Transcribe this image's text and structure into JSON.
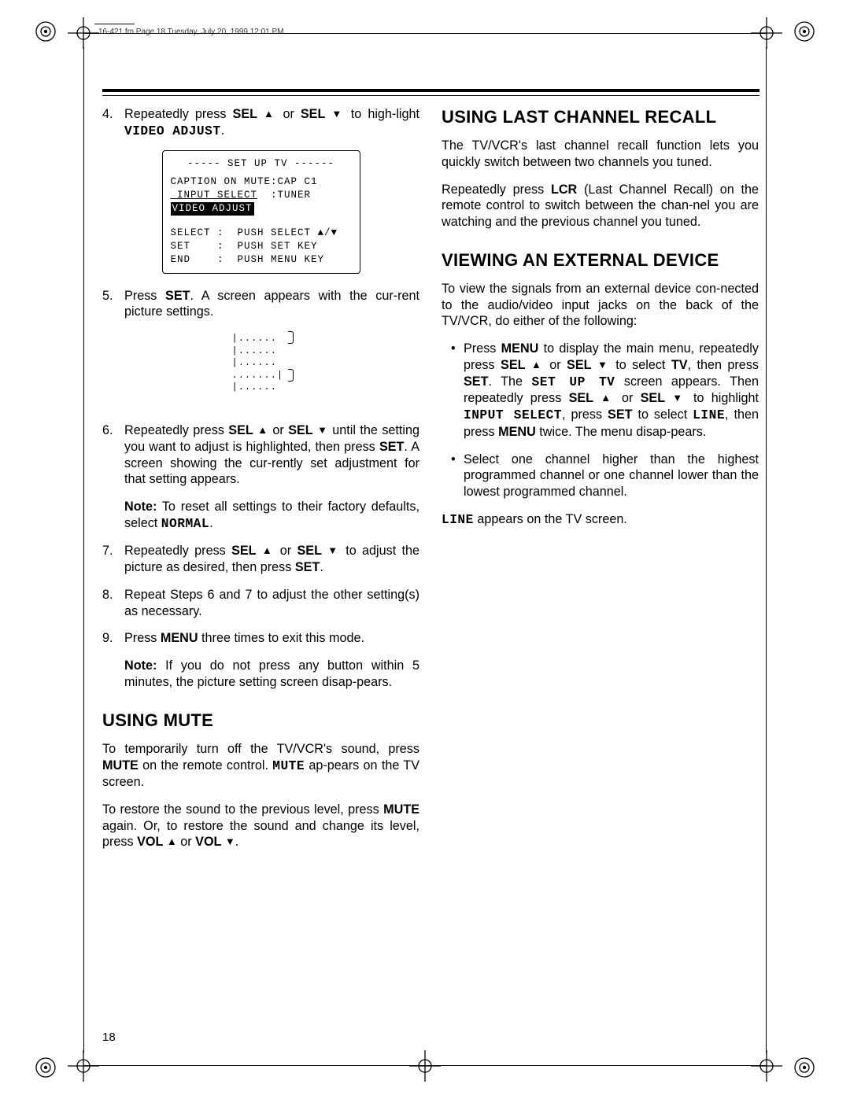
{
  "header": {
    "running": "16-421.fm  Page 18  Tuesday, July 20, 1999  12:01 PM"
  },
  "page_number": "18",
  "left": {
    "step4": {
      "num": "4.",
      "text_a": "Repeatedly press ",
      "sel": "SEL",
      "or": " or ",
      "text_b": " to high-light ",
      "video_adjust": "VIDEO ADJUST",
      "period": "."
    },
    "osd": {
      "title": "----- SET UP TV ------",
      "row1_label": "CAPTION ON MUTE",
      "row1_val": ":CAP C1",
      "row2_label": " INPUT SELECT",
      "row2_val": "  :TUNER",
      "row3_hl": "VIDEO ADJUST",
      "help1": "SELECT :  PUSH SELECT ▲/▼",
      "help2": "SET    :  PUSH SET KEY",
      "help3": "END    :  PUSH MENU KEY"
    },
    "step5": {
      "num": "5.",
      "a": "Press ",
      "set": "SET",
      "b": ". A screen appears with the cur-rent picture settings."
    },
    "step6": {
      "num": "6.",
      "a": "Repeatedly press ",
      "sel": "SEL",
      "or": " or ",
      "b": " until the setting you want to adjust is highlighted, then press ",
      "set": "SET",
      "c": ". A screen showing the cur-rently set adjustment for that setting appears."
    },
    "note6": {
      "lead": "Note:",
      "a": " To reset all settings to their factory defaults, select ",
      "normal": "NORMAL",
      "b": "."
    },
    "step7": {
      "num": "7.",
      "a": "Repeatedly press ",
      "sel": "SEL",
      "or": " or ",
      "b": " to adjust the picture as desired, then press ",
      "set": "SET",
      "c": "."
    },
    "step8": {
      "num": "8.",
      "text": "Repeat Steps 6 and 7 to adjust the other setting(s) as necessary."
    },
    "step9": {
      "num": "9.",
      "a": "Press ",
      "menu": "MENU",
      "b": " three times to exit this mode."
    },
    "note9": {
      "lead": "Note:",
      "text": " If you do not press any button within 5 minutes, the picture setting screen disap-pears."
    },
    "mute": {
      "heading": "USING MUTE",
      "p1_a": "To temporarily turn off the TV/VCR's sound, press ",
      "p1_mute": "MUTE",
      "p1_b": " on the remote control. ",
      "p1_mute2": "MUTE",
      "p1_c": " ap-pears on the TV screen.",
      "p2_a": "To restore the sound to the previous level, press ",
      "p2_mute": "MUTE",
      "p2_b": " again. Or, to restore the sound and change its level, press ",
      "p2_vol": "VOL",
      "p2_or": " or ",
      "p2_c": "."
    }
  },
  "right": {
    "lcr": {
      "heading": "USING LAST CHANNEL RECALL",
      "p1": "The TV/VCR's last channel recall function lets you quickly switch between two channels you tuned.",
      "p2_a": "Repeatedly press ",
      "p2_lcr": "LCR",
      "p2_b": " (Last Channel Recall) on the remote control to switch between the chan-nel you are watching and the previous channel you tuned."
    },
    "ext": {
      "heading": "VIEWING AN EXTERNAL DEVICE",
      "intro": "To view the signals from an external device con-nected to the audio/video input jacks on the back of the TV/VCR, do either of the following:",
      "b1": {
        "a": "Press ",
        "menu": "MENU",
        "b": " to display the main menu, repeatedly press ",
        "sel": "SEL",
        "or": " or ",
        "c": " to select ",
        "tv": "TV",
        "d": ", then press ",
        "set": "SET",
        "e": ". The ",
        "setup": "SET UP TV",
        "f": " screen appears. Then repeatedly press ",
        "g": " to highlight ",
        "input_select": "INPUT SELECT",
        "h": ", press ",
        "i": " to select ",
        "line": "LINE",
        "j": ", then press ",
        "menu2": "MENU",
        "k": " twice. The menu disap-pears."
      },
      "b2": "Select one channel higher than the highest programmed channel or one channel lower than the lowest programmed channel.",
      "tail_a": "LINE",
      "tail_b": " appears on the TV screen."
    }
  }
}
